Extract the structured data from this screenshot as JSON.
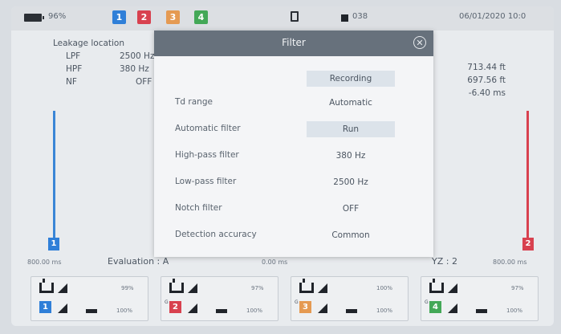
{
  "status_bar": {
    "battery": "96%",
    "channels": [
      {
        "label": "1",
        "color": "#2f7fd8"
      },
      {
        "label": "2",
        "color": "#d8414f"
      },
      {
        "label": "3",
        "color": "#e59a52"
      },
      {
        "label": "4",
        "color": "#43a857"
      }
    ],
    "record_count": "038",
    "datetime": "06/01/2020 10:0"
  },
  "info": {
    "title": "Leakage location",
    "rows": [
      {
        "label": "LPF",
        "value": "2500 Hz"
      },
      {
        "label": "HPF",
        "value": "380 Hz"
      },
      {
        "label": "NF",
        "value": "OFF"
      }
    ],
    "right_values": [
      "713.44 ft",
      "697.56 ft",
      "-6.40 ms"
    ]
  },
  "chart": {
    "left_marker": "1",
    "right_marker": "2",
    "left_time": "800.00 ms",
    "center_time": "0.00 ms",
    "right_time": "800.00 ms",
    "evaluation": "Evaluation : A",
    "yz": "YZ : 2"
  },
  "sensors": [
    {
      "top_pct": "99%",
      "bottom_pct": "100%",
      "badge": "1",
      "color": "#2f7fd8",
      "g_tag": ""
    },
    {
      "top_pct": "97%",
      "bottom_pct": "100%",
      "badge": "2",
      "color": "#d8414f",
      "g_tag": "G"
    },
    {
      "top_pct": "100%",
      "bottom_pct": "100%",
      "badge": "3",
      "color": "#e59a52",
      "g_tag": "G"
    },
    {
      "top_pct": "97%",
      "bottom_pct": "100%",
      "badge": "4",
      "color": "#43a857",
      "g_tag": "G"
    }
  ],
  "dialog": {
    "title": "Filter",
    "recording_button": "Recording",
    "rows": [
      {
        "label": "Td range",
        "value": "Automatic",
        "button": false
      },
      {
        "label": "Automatic filter",
        "value": "Run",
        "button": true
      },
      {
        "label": "High-pass filter",
        "value": "380 Hz",
        "button": false
      },
      {
        "label": "Low-pass filter",
        "value": "2500 Hz",
        "button": false
      },
      {
        "label": "Notch filter",
        "value": "OFF",
        "button": false
      },
      {
        "label": "Detection accuracy",
        "value": "Common",
        "button": false
      }
    ]
  }
}
